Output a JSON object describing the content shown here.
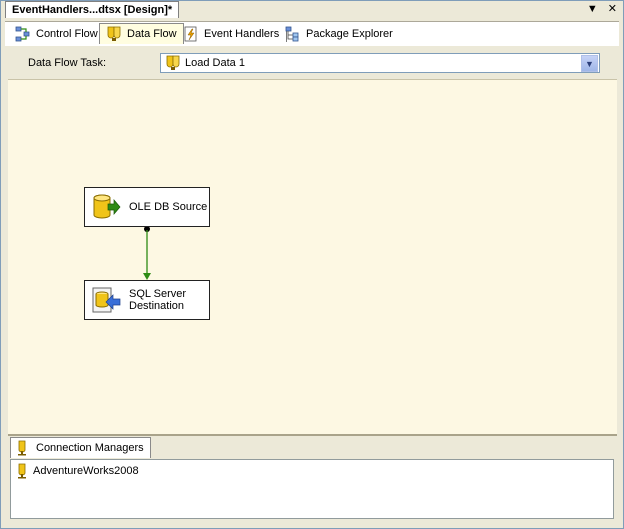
{
  "document": {
    "tab_title": "EventHandlers...dtsx [Design]*",
    "controls": {
      "dropdown": "▼",
      "close": "✕"
    }
  },
  "designer_tabs": [
    {
      "label": "Control Flow",
      "icon": "control-flow-icon"
    },
    {
      "label": "Data Flow",
      "icon": "data-flow-icon",
      "active": true
    },
    {
      "label": "Event Handlers",
      "icon": "event-handlers-icon"
    },
    {
      "label": "Package Explorer",
      "icon": "package-explorer-icon"
    }
  ],
  "task_selector": {
    "label": "Data Flow Task:",
    "value": "Load Data 1"
  },
  "components": {
    "source": {
      "label": "OLE DB Source",
      "icon": "ole-db-source-icon"
    },
    "destination": {
      "label_line1": "SQL Server",
      "label_line2": "Destination",
      "icon": "sql-server-destination-icon"
    },
    "path_color": "#2e8b14"
  },
  "connection_managers": {
    "tab_label": "Connection Managers",
    "items": [
      "AdventureWorks2008"
    ]
  }
}
